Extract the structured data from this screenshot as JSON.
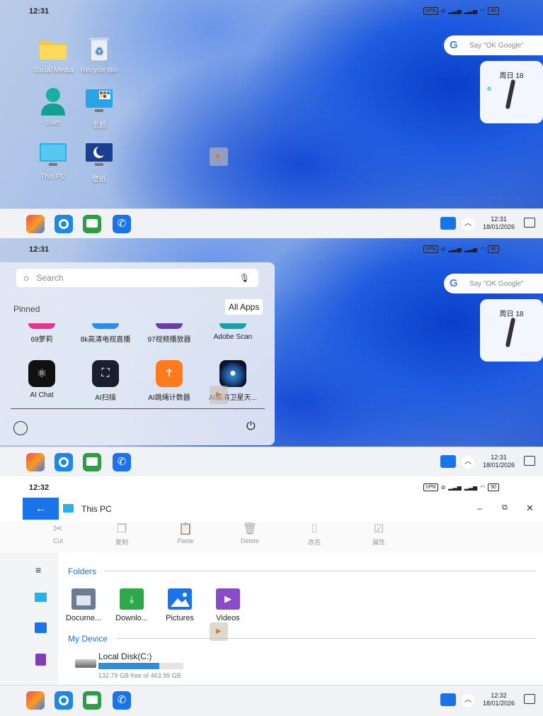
{
  "panel1": {
    "time": "12:31",
    "status_icons": {
      "vpn": "VPN",
      "signal1": "5G",
      "battery": "90"
    },
    "desktop_icons": [
      {
        "label": "Social Media",
        "icon": "folder-icon"
      },
      {
        "label": "Recycle Bin",
        "icon": "recycle-bin-icon"
      },
      {
        "label": "User",
        "icon": "user-icon"
      },
      {
        "label": "主题",
        "icon": "theme-monitor-icon"
      },
      {
        "label": "This PC",
        "icon": "this-pc-icon"
      },
      {
        "label": "壁纸",
        "icon": "wallpaper-icon"
      }
    ],
    "google_placeholder": "Say \"OK Google\"",
    "calendar_label": "周日 18",
    "taskbar_time": "12:31",
    "taskbar_date": "18/01/2026"
  },
  "panel2": {
    "time": "12:31",
    "search_placeholder": "Search",
    "pinned_label": "Pinned",
    "all_apps_label": "All Apps",
    "row1": [
      "69萝莉",
      "8k高清电视直播",
      "97视频播放器",
      "Adobe Scan"
    ],
    "row2": [
      "AI Chat",
      "AI扫描",
      "AI跳绳计数器",
      "AI高清卫星天..."
    ],
    "google_placeholder": "Say \"OK Google\"",
    "calendar_label": "周日 18",
    "taskbar_time": "12:31",
    "taskbar_date": "18/01/2026"
  },
  "panel3": {
    "time": "12:32",
    "window_title": "This PC",
    "toolbar": [
      "Cut",
      "复制",
      "Paste",
      "Delete",
      "改名",
      "属性"
    ],
    "folders_label": "Folders",
    "folders": [
      "Docume...",
      "Downlo...",
      "Pictures",
      "Videos"
    ],
    "my_device_label": "My Device",
    "disk_name": "Local Disk(C:)",
    "disk_free": "132.79 GB free of 463.99 GB",
    "disk_used_fraction": 0.714,
    "taskbar_time": "12:32",
    "taskbar_date": "18/01/2026"
  },
  "colors": {
    "accent": "#1a73e8",
    "window_back": "#1a73e8"
  }
}
